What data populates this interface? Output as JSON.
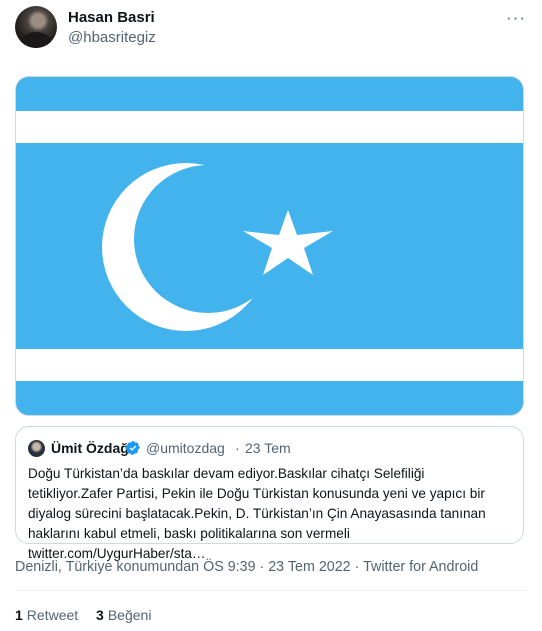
{
  "author": {
    "name": "Hasan Basri",
    "handle": "@hbasritegiz"
  },
  "more_icon": "more-horizontal-icon",
  "more_glyph": "···",
  "media": {
    "colors": {
      "field": "#43b3ee",
      "stripe": "#ffffff",
      "emblem": "#ffffff"
    }
  },
  "quote": {
    "name": "Ümit Özdağ",
    "verified_icon": "verified-badge-icon",
    "verified_color": "#1d9bf0",
    "handle": "@umitozdag",
    "separator": "·",
    "date": "23 Tem",
    "text": "Doğu Türkistan’da baskılar devam ediyor.Baskılar cihatçı Selefiliği tetikliyor.Zafer Partisi, Pekin ile Doğu Türkistan konusunda yeni ve yapıcı bir diyalog sürecini başlatacak.Pekin, D. Türkistan’ın Çin Anayasasında tanınan haklarını kabul etmeli, baskı politikalarına son vermeli twitter.com/UygurHaber/sta…"
  },
  "meta": {
    "line": "Denizli, Türkiye konumundan ÖS 9:39 · 23 Tem 2022 · Twitter for Android"
  },
  "stats": {
    "retweets_count": "1",
    "retweets_label": "Retweet",
    "likes_count": "3",
    "likes_label": "Beğeni"
  }
}
